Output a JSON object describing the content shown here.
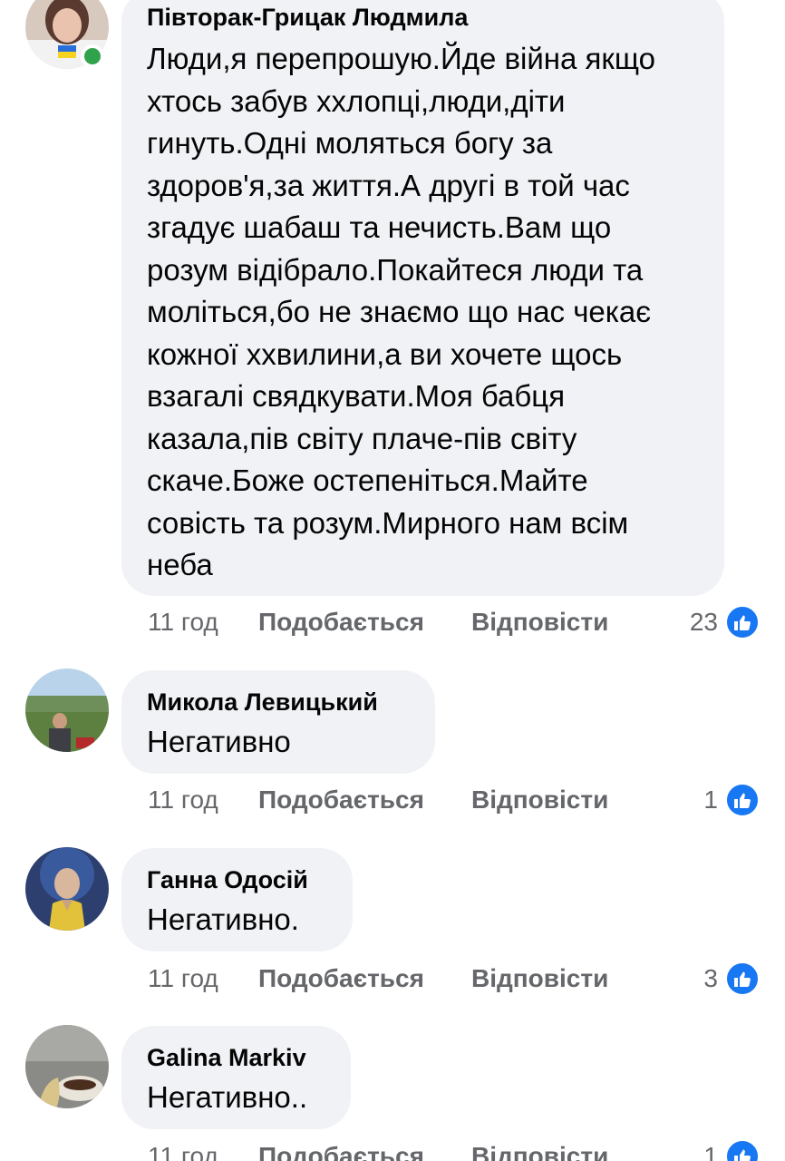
{
  "colors": {
    "bubble_bg": "#f0f2f5",
    "meta_text": "#65676b",
    "like_blue": "#1877f2",
    "online_green": "#31a24c"
  },
  "comments": [
    {
      "author": "Півторак-Грицак Людмила",
      "avatar_icon": "user-avatar-icon",
      "online": true,
      "lines": [
        "Люди,я перепрошую.Йде війна якщо",
        "хтось забув ххлопці,люди,діти",
        "гинуть.Одні моляться богу за",
        "здоров'я,за життя.А другі в той час",
        "згадує шабаш та нечисть.Вам що",
        "розум відібрало.Покайтеся люди та",
        "моліться,бо не знаємо що нас чекає",
        "кожної ххвилини,а ви хочете щось",
        "взагалі свядкувати.Моя бабця",
        "казала,пів світу плаче-пів світу",
        "скаче.Боже остепеніться.Майте",
        "совість та розум.Мирного нам всім",
        "неба"
      ],
      "time": "11 год",
      "like_label": "Подобається",
      "reply_label": "Відповісти",
      "reaction_count": "23"
    },
    {
      "author": "Микола Левицький",
      "avatar_icon": "user-avatar-icon",
      "online": false,
      "lines": [
        "Негативно"
      ],
      "time": "11 год",
      "like_label": "Подобається",
      "reply_label": "Відповісти",
      "reaction_count": "1"
    },
    {
      "author": "Ганна Одосій",
      "avatar_icon": "user-avatar-icon",
      "online": false,
      "lines": [
        "Негативно."
      ],
      "time": "11 год",
      "like_label": "Подобається",
      "reply_label": "Відповісти",
      "reaction_count": "3"
    },
    {
      "author": "Galina Markiv",
      "avatar_icon": "user-avatar-icon",
      "online": false,
      "lines": [
        "Негативно.."
      ],
      "time": "11 год",
      "like_label": "Подобається",
      "reply_label": "Відповісти",
      "reaction_count": "1"
    }
  ]
}
